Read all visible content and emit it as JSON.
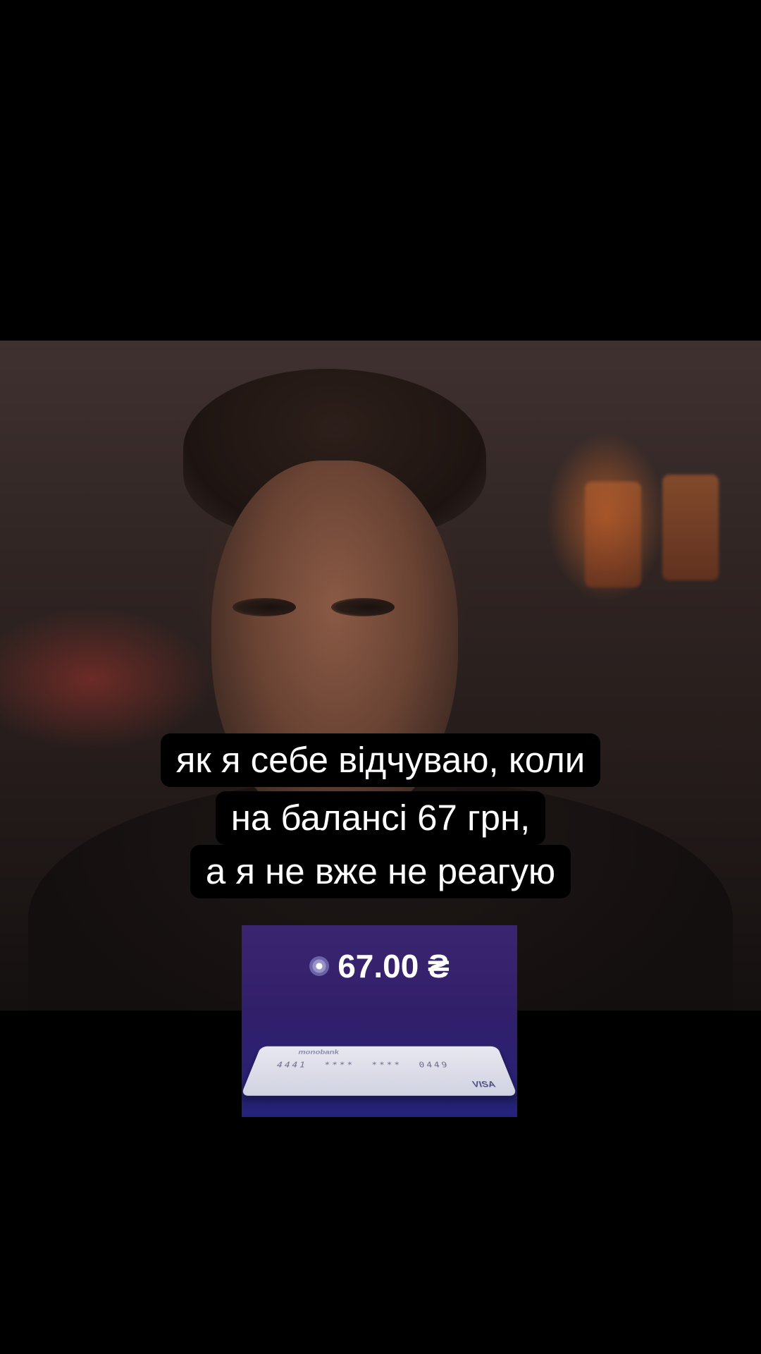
{
  "caption": {
    "line1": "як я себе відчуваю, коли",
    "line2": "на балансі 67 грн,",
    "line3": "а я не вже не реагую"
  },
  "balance": {
    "amount": "67.00 ₴",
    "icon": "coin-icon"
  },
  "card": {
    "bank": "monobank",
    "number": "4441 **** **** 0449",
    "network": "VISA"
  }
}
